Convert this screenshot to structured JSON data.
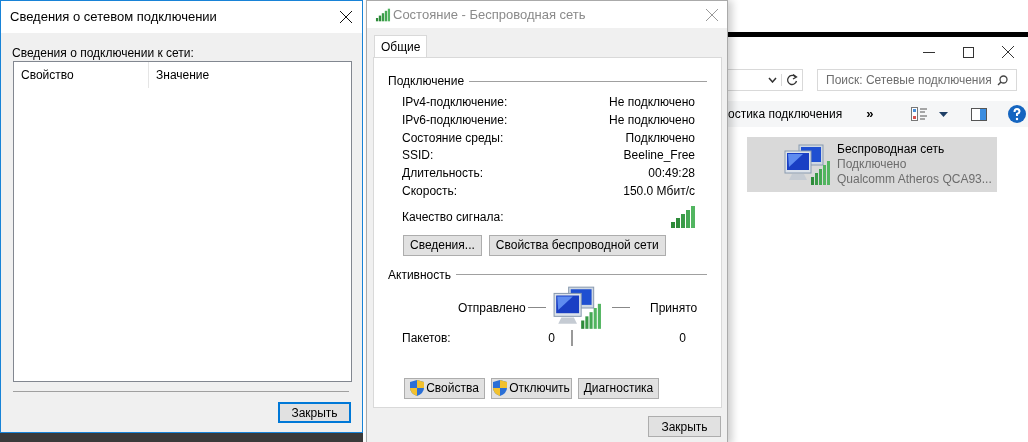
{
  "details_dialog": {
    "title": "Сведения о сетевом подключении",
    "label": "Сведения о подключении к сети:",
    "columns": [
      "Свойство",
      "Значение"
    ],
    "close_button": "Закрыть"
  },
  "status_dialog": {
    "title": "Состояние - Беспроводная сеть",
    "tabs": [
      {
        "label": "Общие",
        "selected": true
      }
    ],
    "connection": {
      "heading": "Подключение",
      "rows": [
        {
          "label": "IPv4-подключение:",
          "value": "Не подключено"
        },
        {
          "label": "IPv6-подключение:",
          "value": "Не подключено"
        },
        {
          "label": "Состояние среды:",
          "value": "Подключено"
        },
        {
          "label": "SSID:",
          "value": "Beeline_Free"
        },
        {
          "label": "Длительность:",
          "value": "00:49:28"
        },
        {
          "label": "Скорость:",
          "value": "150.0 Мбит/с"
        }
      ],
      "signal_label": "Качество сигнала:",
      "buttons": [
        "Сведения...",
        "Свойства беспроводной сети"
      ]
    },
    "activity": {
      "heading": "Активность",
      "sent_label": "Отправлено",
      "received_label": "Принято",
      "packets_label": "Пакетов:",
      "packets_sent": "0",
      "packets_received": "0"
    },
    "buttons": [
      {
        "label": "Свойства",
        "shield": true
      },
      {
        "label": "Отключить",
        "shield": true
      },
      {
        "label": "Диагностика",
        "shield": false
      }
    ],
    "close_button": "Закрыть"
  },
  "explorer": {
    "search_placeholder": "Поиск: Сетевые подключения",
    "toolbar_item": "остика подключения",
    "toolbar_more": "»",
    "connection": {
      "name": "Беспроводная сеть",
      "status": "Подключено",
      "adapter": "Qualcomm Atheros QCA93...",
      "selected": true
    }
  }
}
